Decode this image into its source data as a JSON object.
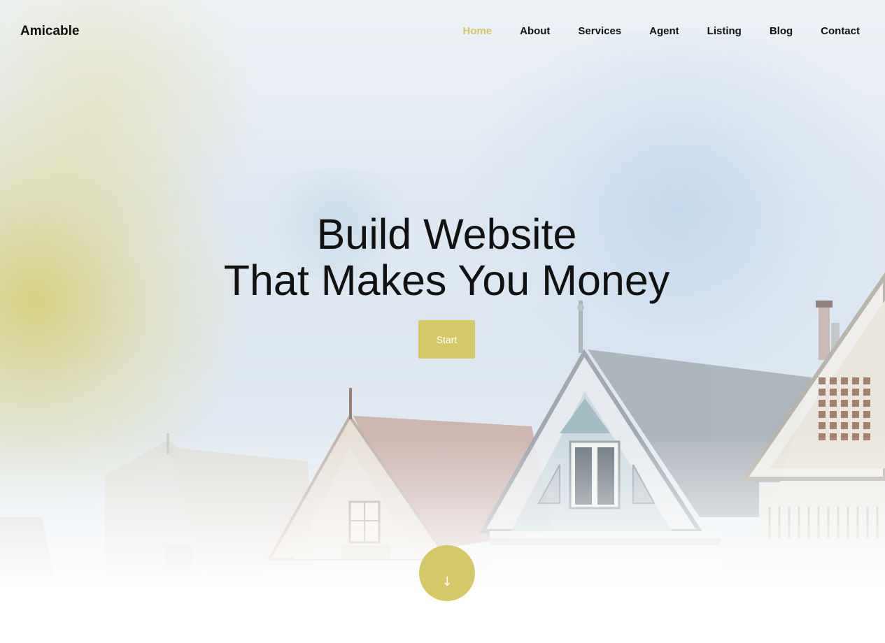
{
  "brand": {
    "name": "Amicable"
  },
  "nav": {
    "items": [
      {
        "label": "Home",
        "active": true
      },
      {
        "label": "About",
        "active": false
      },
      {
        "label": "Services",
        "active": false
      },
      {
        "label": "Agent",
        "active": false
      },
      {
        "label": "Listing",
        "active": false
      },
      {
        "label": "Blog",
        "active": false
      },
      {
        "label": "Contact",
        "active": false
      }
    ]
  },
  "hero": {
    "headline_line1": "Build Website",
    "headline_line2": "That Makes You Money",
    "cta_label": "Start",
    "scroll_icon": "arrow-down-icon",
    "scroll_glyph": "↓"
  },
  "colors": {
    "accent": "#d4c868",
    "active_nav": "#d4c66a",
    "text": "#111111"
  }
}
